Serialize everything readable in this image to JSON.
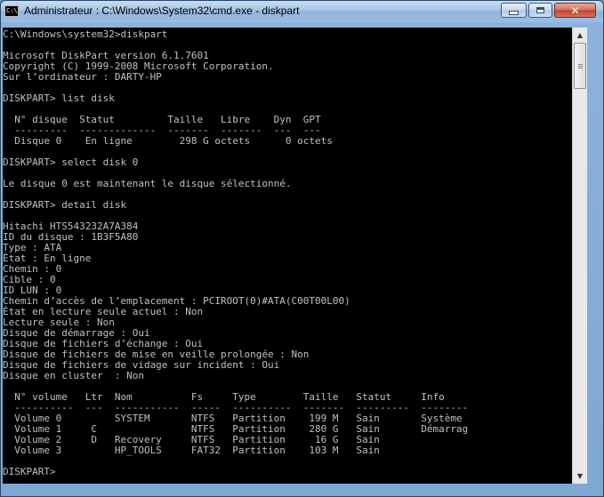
{
  "window": {
    "title": "Administrateur : C:\\Windows\\System32\\cmd.exe - diskpart",
    "icon_text": "C:\\",
    "close_glyph": "✕"
  },
  "console": {
    "lines": [
      "C:\\Windows\\system32>diskpart",
      "",
      "Microsoft DiskPart version 6.1.7601",
      "Copyright (C) 1999-2008 Microsoft Corporation.",
      "Sur l’ordinateur : DARTY-HP",
      "",
      "DISKPART> list disk",
      "",
      "  N° disque  Statut         Taille   Libre    Dyn  GPT",
      "  ---------  -------------  -------  -------  ---  ---",
      "  Disque 0    En ligne        298 G octets      0 octets",
      "",
      "DISKPART> select disk 0",
      "",
      "Le disque 0 est maintenant le disque sélectionné.",
      "",
      "DISKPART> detail disk",
      "",
      "Hitachi HTS543232A7A384",
      "ID du disque : 1B3F5A80",
      "Type : ATA",
      "État : En ligne",
      "Chemin : 0",
      "Cible : 0",
      "ID LUN : 0",
      "Chemin d’accès de l’emplacement : PCIROOT(0)#ATA(C00T00L00)",
      "État en lecture seule actuel : Non",
      "Lecture seule : Non",
      "Disque de démarrage : Oui",
      "Disque de fichiers d’échange : Oui",
      "Disque de fichiers de mise en veille prolongée : Non",
      "Disque de fichiers de vidage sur incident : Oui",
      "Disque en cluster  : Non",
      "",
      "  N° volume   Ltr  Nom          Fs     Type        Taille   Statut     Info",
      "  ----------  ---  -----------  -----  ----------  -------  ---------  --------",
      "  Volume 0         SYSTEM       NTFS   Partition    199 M   Sain       Système",
      "  Volume 1     C                NTFS   Partition    280 G   Sain       Démarrag",
      "  Volume 2     D   Recovery     NTFS   Partition     16 G   Sain",
      "  Volume 3         HP_TOOLS     FAT32  Partition    103 M   Sain",
      "",
      "DISKPART> "
    ]
  },
  "scrollbar": {
    "up_glyph": "▲",
    "down_glyph": "▼"
  }
}
